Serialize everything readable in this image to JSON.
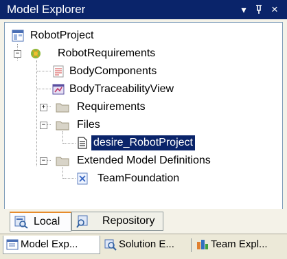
{
  "window": {
    "title": "Model Explorer",
    "controls": {
      "dropdown": "▾",
      "pin": "ᵖ",
      "close": "×"
    }
  },
  "tree": {
    "root": {
      "label": "RobotProject",
      "icon": "project-icon"
    },
    "requirements_model": {
      "label": "RobotRequirements",
      "icon": "model-icon",
      "expanded": true
    },
    "body_components": {
      "label": "BodyComponents",
      "icon": "diagram-icon"
    },
    "body_traceability_view": {
      "label": "BodyTraceabilityView",
      "icon": "traceability-view-icon"
    },
    "requirements_folder": {
      "label": "Requirements",
      "icon": "folder-icon",
      "expanded": false
    },
    "files_folder": {
      "label": "Files",
      "icon": "folder-icon",
      "expanded": true
    },
    "desire_file": {
      "label": "desire_RobotProject",
      "icon": "file-icon",
      "selected": true
    },
    "extended_defs_folder": {
      "label": "Extended Model Definitions",
      "icon": "folder-icon",
      "expanded": true
    },
    "team_foundation": {
      "label": "TeamFoundation",
      "icon": "xml-icon"
    }
  },
  "inner_tabs": [
    {
      "label": "Local",
      "icon": "local-icon",
      "active": true
    },
    {
      "label": "Repository",
      "icon": "repository-icon",
      "active": false
    }
  ],
  "outer_tabs": [
    {
      "label": "Model Exp...",
      "icon": "model-explorer-icon",
      "active": true
    },
    {
      "label": "Solution E...",
      "icon": "solution-explorer-icon",
      "active": false
    },
    {
      "label": "Team Expl...",
      "icon": "team-explorer-icon",
      "active": false
    }
  ],
  "colors": {
    "titlebar": "#0a246a",
    "selection": "#0a246a",
    "folder": "#d4c486",
    "tab_accent": "#e68b2c"
  }
}
